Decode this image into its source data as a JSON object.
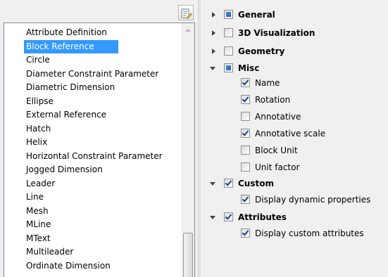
{
  "toolbar": {
    "edit_button_icon": "edit-list-icon"
  },
  "entity_list": {
    "selected_index": 1,
    "items": [
      "Attribute Definition",
      "Block Reference",
      "Circle",
      "Diameter Constraint Parameter",
      "Diametric Dimension",
      "Ellipse",
      "External Reference",
      "Hatch",
      "Helix",
      "Horizontal Constraint Parameter",
      "Jogged Dimension",
      "Leader",
      "Line",
      "Mesh",
      "MLine",
      "MText",
      "Multileader",
      "Ordinate Dimension"
    ]
  },
  "property_tree": {
    "general": {
      "label": "General",
      "expanded": false,
      "state": "indeterminate"
    },
    "visualization_3d": {
      "label": "3D Visualization",
      "expanded": false,
      "state": "unchecked"
    },
    "geometry": {
      "label": "Geometry",
      "expanded": false,
      "state": "unchecked"
    },
    "misc": {
      "label": "Misc",
      "expanded": true,
      "state": "indeterminate",
      "children": [
        {
          "label": "Name",
          "checked": true
        },
        {
          "label": "Rotation",
          "checked": true
        },
        {
          "label": "Annotative",
          "checked": false
        },
        {
          "label": "Annotative scale",
          "checked": true
        },
        {
          "label": "Block Unit",
          "checked": false
        },
        {
          "label": "Unit factor",
          "checked": false
        }
      ]
    },
    "custom": {
      "label": "Custom",
      "expanded": true,
      "state": "checked",
      "children": [
        {
          "label": "Display dynamic properties",
          "checked": true
        }
      ]
    },
    "attributes": {
      "label": "Attributes",
      "expanded": true,
      "state": "checked",
      "children": [
        {
          "label": "Display custom attributes",
          "checked": true
        }
      ]
    }
  }
}
